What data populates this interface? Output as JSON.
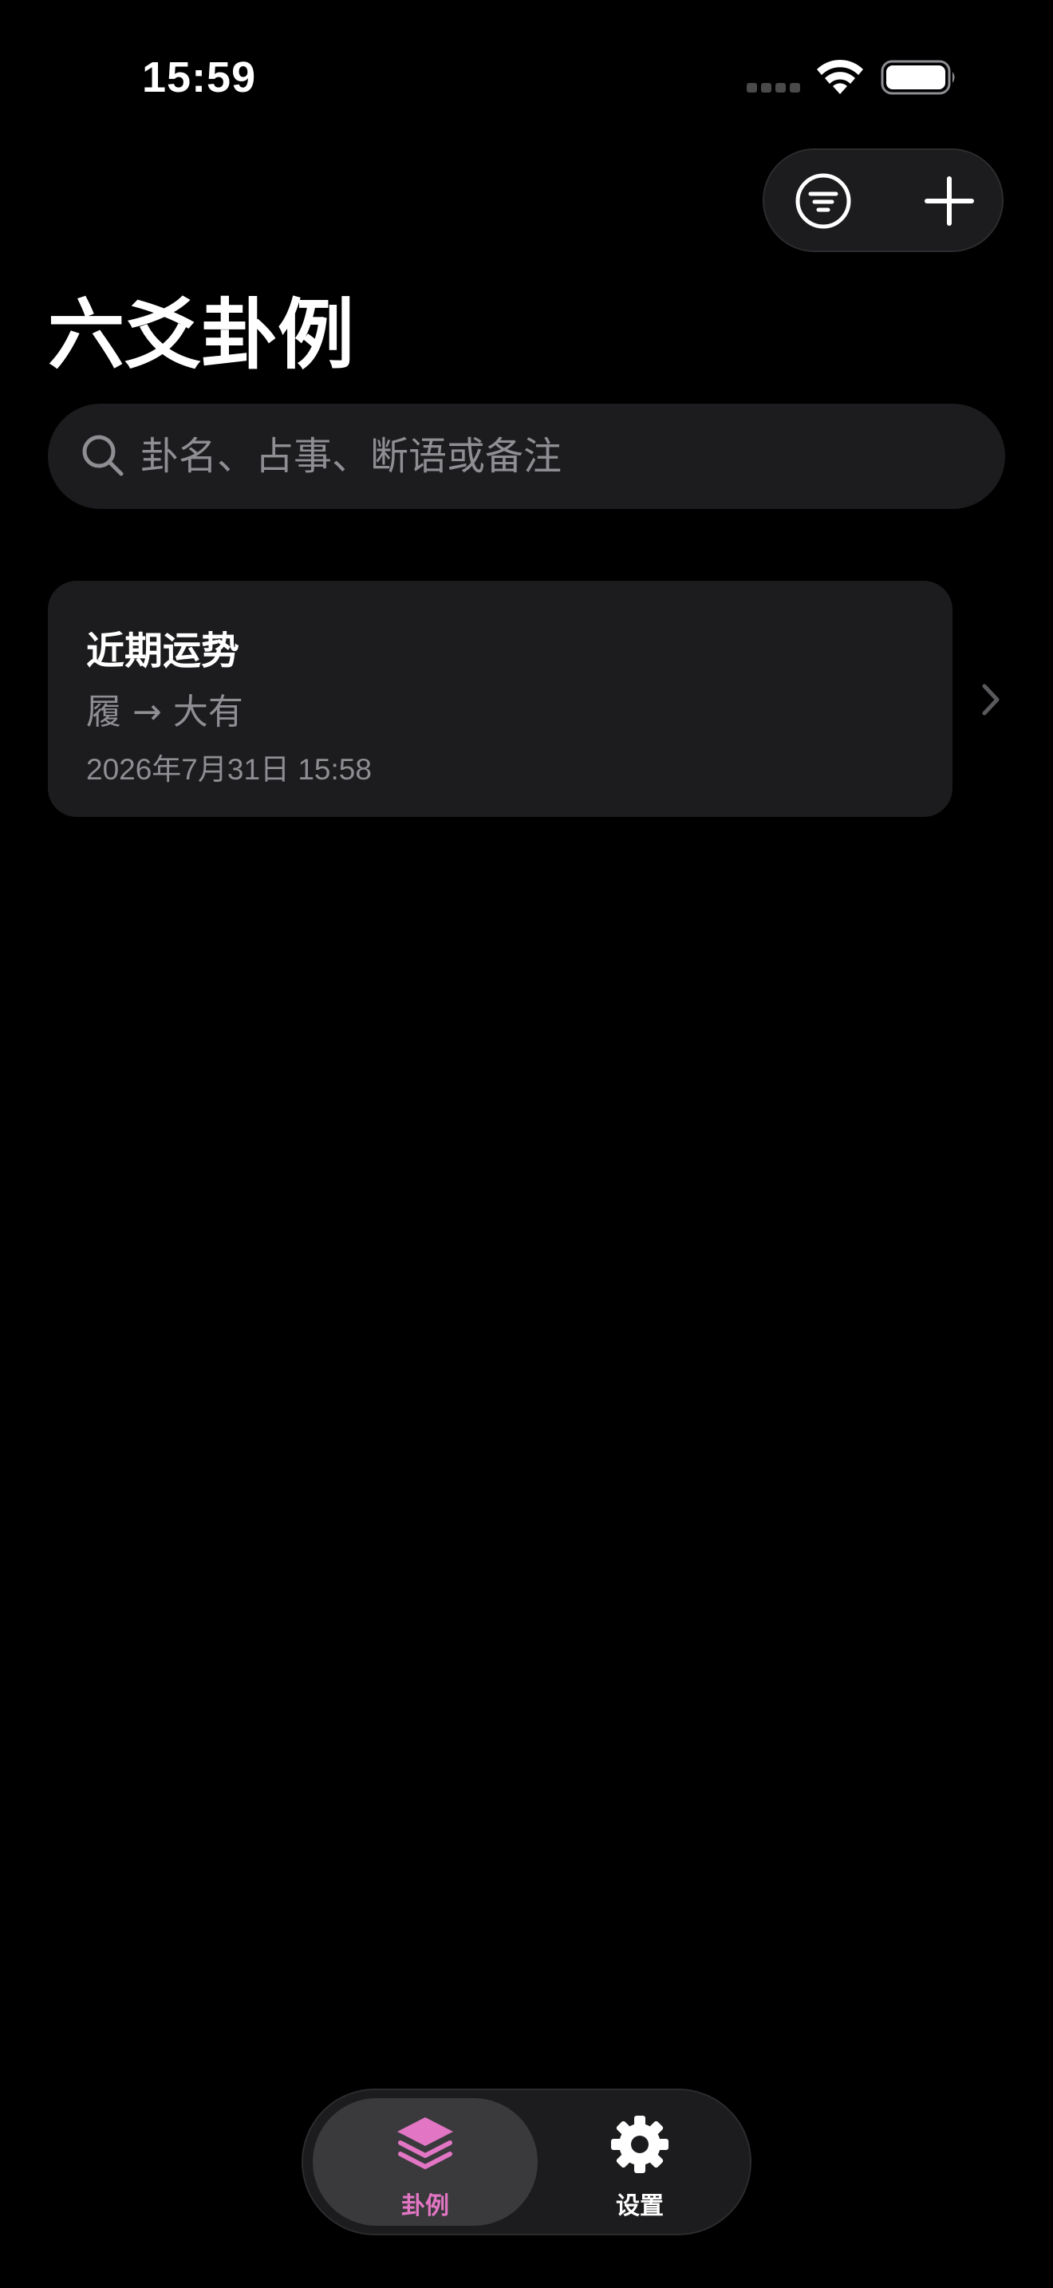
{
  "status_bar": {
    "time": "15:59"
  },
  "header": {
    "title": "六爻卦例"
  },
  "search": {
    "placeholder": "卦名、占事、断语或备注",
    "value": ""
  },
  "records": [
    {
      "title": "近期运势",
      "hexagram": "履 → 大有",
      "date": "2026年7月31日 15:58"
    }
  ],
  "tab_bar": {
    "tabs": [
      {
        "label": "卦例",
        "icon": "layers-icon",
        "selected": true
      },
      {
        "label": "设置",
        "icon": "gear-icon",
        "selected": false
      }
    ]
  },
  "colors": {
    "background": "#000000",
    "surface": "#1c1c1e",
    "secondary_text": "#8e8e93",
    "accent": "#e376c4",
    "selected_tab": "#3a3a3c"
  }
}
